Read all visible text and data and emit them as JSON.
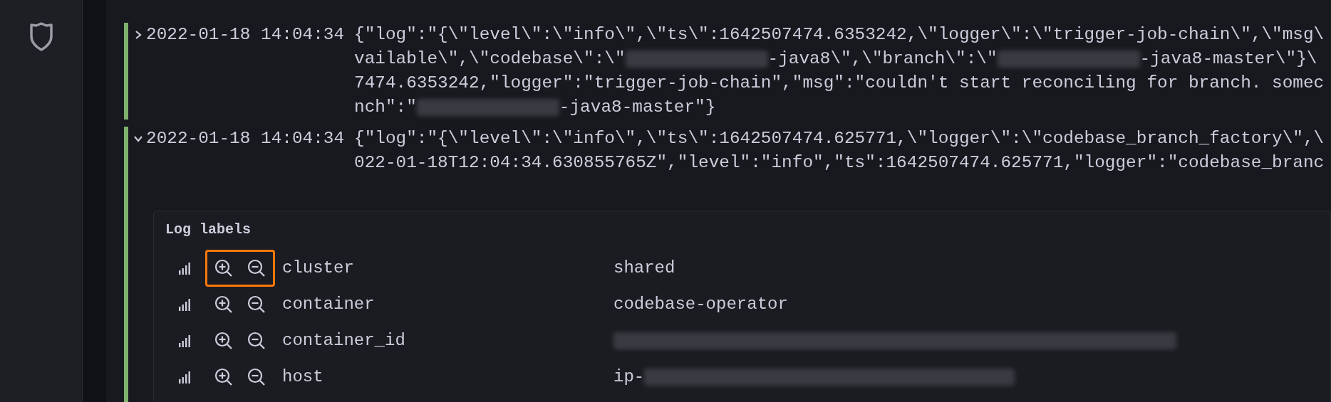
{
  "entries": [
    {
      "timestamp": "2022-01-18 14:04:34",
      "expanded": false,
      "color": "#7eb26d",
      "lines": [
        [
          {
            "kind": "text",
            "text": "{\"log\":\"{\\\"level\\\":\\\"info\\\",\\\"ts\\\":1642507474.6353242,\\\"logger\\\":\\\"trigger-job-chain\\\",\\\"msg\\"
          }
        ],
        [
          {
            "kind": "text",
            "text": "vailable\\\",\\\"codebase\\\":\\\""
          },
          {
            "kind": "blur"
          },
          {
            "kind": "text",
            "text": "-java8\\\",\\\"branch\\\":\\\""
          },
          {
            "kind": "blur"
          },
          {
            "kind": "text",
            "text": "-java8-master\\\"}\\"
          }
        ],
        [
          {
            "kind": "text",
            "text": "7474.6353242,\"logger\":\"trigger-job-chain\",\"msg\":\"couldn't start reconciling for branch. somec"
          }
        ],
        [
          {
            "kind": "text",
            "text": "nch\":\""
          },
          {
            "kind": "blur"
          },
          {
            "kind": "text",
            "text": "-java8-master\"}"
          }
        ]
      ]
    },
    {
      "timestamp": "2022-01-18 14:04:34",
      "expanded": true,
      "color": "#7eb26d",
      "lines": [
        [
          {
            "kind": "text",
            "text": "{\"log\":\"{\\\"level\\\":\\\"info\\\",\\\"ts\\\":1642507474.625771,\\\"logger\\\":\\\"codebase_branch_factory\\\",\\"
          }
        ],
        [
          {
            "kind": "text",
            "text": "022-01-18T12:04:34.630855765Z\",\"level\":\"info\",\"ts\":1642507474.625771,\"logger\":\"codebase_branc"
          }
        ]
      ],
      "details": {
        "title": "Log labels",
        "labels": [
          {
            "key": "cluster",
            "highlighted": true,
            "value": [
              {
                "kind": "text",
                "text": "shared"
              }
            ]
          },
          {
            "key": "container",
            "highlighted": false,
            "value": [
              {
                "kind": "text",
                "text": "codebase-operator"
              }
            ]
          },
          {
            "key": "container_id",
            "highlighted": false,
            "value": [
              {
                "kind": "longblur"
              }
            ]
          },
          {
            "key": "host",
            "highlighted": false,
            "value": [
              {
                "kind": "text",
                "text": "ip-"
              },
              {
                "kind": "wideblur"
              }
            ]
          }
        ]
      }
    }
  ]
}
